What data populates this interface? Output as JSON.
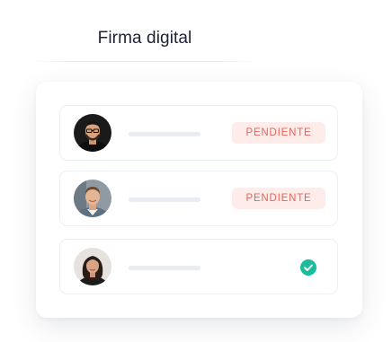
{
  "header": {
    "title": "Firma digital"
  },
  "signers": [
    {
      "status": "PENDIENTE",
      "state": "pending",
      "avatar_icon": "person-avatar-glasses-icon"
    },
    {
      "status": "PENDIENTE",
      "state": "pending",
      "avatar_icon": "person-avatar-icon"
    },
    {
      "status": "",
      "state": "signed",
      "avatar_icon": "person-avatar-icon"
    }
  ],
  "colors": {
    "title_text": "#1c2233",
    "pending_bg": "#fdecea",
    "pending_text": "#e3645c",
    "signed_check": "#1abc9c",
    "placeholder": "#e9ecf1"
  }
}
